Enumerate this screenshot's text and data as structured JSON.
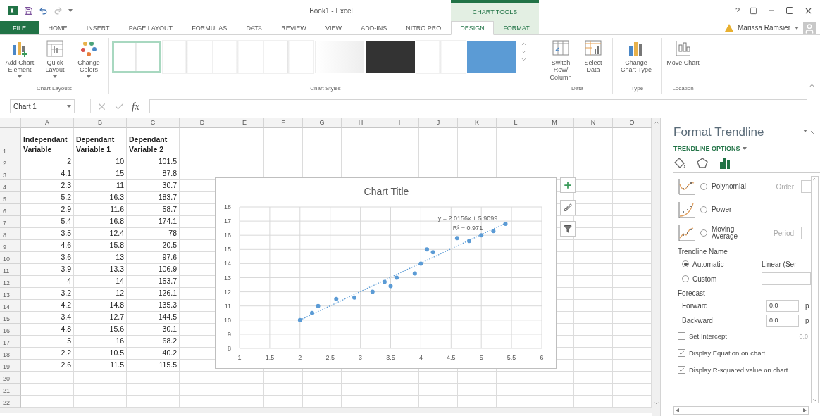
{
  "window": {
    "title": "Book1 - Excel",
    "context_group": "CHART TOOLS",
    "help": "?",
    "user": "Marissa Ramsier"
  },
  "ribbon_tabs": [
    {
      "label": "FILE",
      "kind": "file",
      "selected": false
    },
    {
      "label": "HOME",
      "kind": "main",
      "selected": false
    },
    {
      "label": "INSERT",
      "kind": "main",
      "selected": false
    },
    {
      "label": "PAGE LAYOUT",
      "kind": "main",
      "selected": false
    },
    {
      "label": "FORMULAS",
      "kind": "main",
      "selected": false
    },
    {
      "label": "DATA",
      "kind": "main",
      "selected": false
    },
    {
      "label": "REVIEW",
      "kind": "main",
      "selected": false
    },
    {
      "label": "VIEW",
      "kind": "main",
      "selected": false
    },
    {
      "label": "ADD-INS",
      "kind": "main",
      "selected": false
    },
    {
      "label": "NITRO PRO",
      "kind": "main",
      "selected": false
    },
    {
      "label": "DESIGN",
      "kind": "context",
      "selected": true
    },
    {
      "label": "FORMAT",
      "kind": "context",
      "selected": false
    }
  ],
  "ribbon": {
    "layouts": {
      "label": "Chart Layouts",
      "buttons": [
        {
          "label": "Add Chart Element",
          "kind": "add"
        },
        {
          "label": "Quick Layout",
          "kind": "layout"
        },
        {
          "label": "Change Colors",
          "kind": "colors"
        }
      ]
    },
    "styles": {
      "label": "Chart Styles",
      "items": [
        {
          "kind": "blank",
          "selected": true
        },
        {
          "kind": "blank",
          "selected": false
        },
        {
          "kind": "blank",
          "selected": false
        },
        {
          "kind": "blank",
          "selected": false
        },
        {
          "kind": "gradient",
          "selected": false
        },
        {
          "kind": "dark",
          "selected": false
        },
        {
          "kind": "blank",
          "selected": false
        },
        {
          "kind": "blue",
          "selected": false
        }
      ]
    },
    "groups": [
      {
        "label": "Data",
        "buttons": [
          {
            "label": "Switch Row/ Column",
            "kind": "switch"
          },
          {
            "label": "Select Data",
            "kind": "select"
          }
        ]
      },
      {
        "label": "Type",
        "buttons": [
          {
            "label": "Change Chart Type",
            "kind": "type"
          }
        ]
      },
      {
        "label": "Location",
        "buttons": [
          {
            "label": "Move Chart",
            "kind": "move"
          }
        ]
      }
    ]
  },
  "formula_bar": {
    "name_box": "Chart 1",
    "function_label": "fx"
  },
  "sheet": {
    "columns": [
      "A",
      "B",
      "C",
      "D",
      "E",
      "F",
      "G",
      "H",
      "I",
      "J",
      "K",
      "L",
      "M",
      "N",
      "O"
    ],
    "rows": [
      {
        "number": "1",
        "kind": "header",
        "cells": [
          "Independant Variable",
          "Dependant Variable 1",
          "Dependant Variable 2"
        ]
      },
      {
        "number": "2",
        "kind": "data",
        "cells": [
          "2",
          "10",
          "101.5"
        ]
      },
      {
        "number": "3",
        "kind": "data",
        "cells": [
          "4.1",
          "15",
          "87.8"
        ]
      },
      {
        "number": "4",
        "kind": "data",
        "cells": [
          "2.3",
          "11",
          "30.7"
        ]
      },
      {
        "number": "5",
        "kind": "data",
        "cells": [
          "5.2",
          "16.3",
          "183.7"
        ]
      },
      {
        "number": "6",
        "kind": "data",
        "cells": [
          "2.9",
          "11.6",
          "58.7"
        ]
      },
      {
        "number": "7",
        "kind": "data",
        "cells": [
          "5.4",
          "16.8",
          "174.1"
        ]
      },
      {
        "number": "8",
        "kind": "data",
        "cells": [
          "3.5",
          "12.4",
          "78"
        ]
      },
      {
        "number": "9",
        "kind": "data",
        "cells": [
          "4.6",
          "15.8",
          "20.5"
        ]
      },
      {
        "number": "10",
        "kind": "data",
        "cells": [
          "3.6",
          "13",
          "97.6"
        ]
      },
      {
        "number": "11",
        "kind": "data",
        "cells": [
          "3.9",
          "13.3",
          "106.9"
        ]
      },
      {
        "number": "12",
        "kind": "data",
        "cells": [
          "4",
          "14",
          "153.7"
        ]
      },
      {
        "number": "13",
        "kind": "data",
        "cells": [
          "3.2",
          "12",
          "126.1"
        ]
      },
      {
        "number": "14",
        "kind": "data",
        "cells": [
          "4.2",
          "14.8",
          "135.3"
        ]
      },
      {
        "number": "15",
        "kind": "data",
        "cells": [
          "3.4",
          "12.7",
          "144.5"
        ]
      },
      {
        "number": "16",
        "kind": "data",
        "cells": [
          "4.8",
          "15.6",
          "30.1"
        ]
      },
      {
        "number": "17",
        "kind": "data",
        "cells": [
          "5",
          "16",
          "68.2"
        ]
      },
      {
        "number": "18",
        "kind": "data",
        "cells": [
          "2.2",
          "10.5",
          "40.2"
        ]
      },
      {
        "number": "19",
        "kind": "data",
        "cells": [
          "2.6",
          "11.5",
          "115.5"
        ]
      },
      {
        "number": "20",
        "kind": "data"
      },
      {
        "number": "21",
        "kind": "data"
      },
      {
        "number": "22",
        "kind": "data"
      }
    ]
  },
  "chart": {
    "chart_data": {
      "type": "scatter",
      "title": "Chart Title",
      "x": [
        2,
        4.1,
        2.3,
        5.2,
        2.9,
        5.4,
        3.5,
        4.6,
        3.6,
        3.9,
        4,
        3.2,
        4.2,
        3.4,
        4.8,
        5,
        2.2,
        2.6
      ],
      "series": [
        {
          "color": "#5b9bd5",
          "values": [
            10,
            15,
            11,
            16.3,
            11.6,
            16.8,
            12.4,
            15.8,
            13,
            13.3,
            14,
            12,
            14.8,
            12.7,
            15.6,
            16,
            10.5,
            11.5
          ]
        }
      ],
      "xlim": [
        1,
        6
      ],
      "ylim": [
        8,
        18
      ],
      "xticks": [
        1,
        1.5,
        2,
        2.5,
        3,
        3.5,
        4,
        4.5,
        5,
        5.5,
        6
      ],
      "yticks": [
        8,
        9,
        10,
        11,
        12,
        13,
        14,
        15,
        16,
        17,
        18
      ],
      "grid": true,
      "annotations": [
        "y = 2.0156x + 5.9099",
        "R² = 0.971"
      ]
    }
  },
  "format_pane": {
    "title": "Format Trendline",
    "section": "TRENDLINE OPTIONS",
    "tabs": [
      {
        "kind": "fill",
        "selected": false
      },
      {
        "kind": "effects",
        "selected": false
      },
      {
        "kind": "options",
        "selected": true
      }
    ],
    "trend_types": [
      {
        "label": "Polynomial",
        "kind": "polynomial",
        "selected": false,
        "option_label": "Order"
      },
      {
        "label": "Power",
        "kind": "power",
        "selected": false
      },
      {
        "label": "Moving Average",
        "kind": "moving",
        "selected": false,
        "option_label": "Period"
      }
    ],
    "name_section": {
      "label": "Trendline Name",
      "options": [
        {
          "label": "Automatic",
          "selected": true,
          "value": "Linear (Ser"
        },
        {
          "label": "Custom",
          "selected": false
        }
      ]
    },
    "forecast": {
      "label": "Forecast",
      "fields": [
        {
          "label": "Forward",
          "value": "0.0",
          "unit": "p"
        },
        {
          "label": "Backward",
          "value": "0.0",
          "unit": "p"
        }
      ]
    },
    "checkboxes": [
      {
        "label": "Set Intercept",
        "checked": false,
        "value": "0.0"
      },
      {
        "label": "Display Equation on chart",
        "checked": true
      },
      {
        "label": "Display R-squared value on chart",
        "checked": true
      }
    ]
  }
}
